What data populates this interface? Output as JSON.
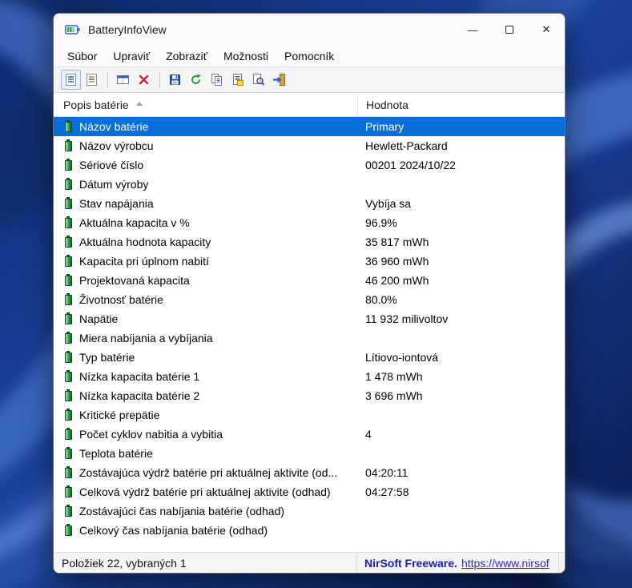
{
  "window": {
    "title": "BatteryInfoView",
    "controls": {
      "minimize": "—",
      "maximize": "□",
      "close": "✕"
    }
  },
  "menubar": {
    "items": [
      "Súbor",
      "Upraviť",
      "Zobraziť",
      "Možnosti",
      "Pomocník"
    ]
  },
  "toolbar": {
    "icons": [
      "report-view-icon",
      "log-view-icon",
      "choose-columns-icon",
      "delete-icon",
      "save-icon",
      "refresh-icon",
      "copy-icon",
      "properties-icon",
      "find-icon",
      "exit-icon"
    ]
  },
  "list": {
    "columns": [
      {
        "label": "Popis batérie",
        "sorted": true
      },
      {
        "label": "Hodnota"
      }
    ],
    "selection_color": "#0a6ed8",
    "row_icon": "battery-icon",
    "rows": [
      {
        "label": "Názov batérie",
        "value": "Primary",
        "selected": true
      },
      {
        "label": "Názov výrobcu",
        "value": "Hewlett-Packard"
      },
      {
        "label": "Sériové číslo",
        "value": "00201 2024/10/22"
      },
      {
        "label": "Dátum výroby",
        "value": ""
      },
      {
        "label": "Stav napájania",
        "value": "Vybíja sa"
      },
      {
        "label": "Aktuálna kapacita v %",
        "value": "96.9%"
      },
      {
        "label": "Aktuálna hodnota kapacity",
        "value": "35 817 mWh"
      },
      {
        "label": "Kapacita pri úplnom nabití",
        "value": "36 960 mWh"
      },
      {
        "label": "Projektovaná kapacita",
        "value": "46 200 mWh"
      },
      {
        "label": "Životnosť batérie",
        "value": "80.0%"
      },
      {
        "label": "Napätie",
        "value": "11 932 milivoltov"
      },
      {
        "label": "Miera nabíjania a vybíjania",
        "value": ""
      },
      {
        "label": "Typ batérie",
        "value": "Lítiovo-iontová"
      },
      {
        "label": "Nízka kapacita batérie 1",
        "value": "1 478 mWh"
      },
      {
        "label": "Nízka kapacita batérie 2",
        "value": "3 696 mWh"
      },
      {
        "label": "Kritické prepätie",
        "value": ""
      },
      {
        "label": "Počet cyklov nabitia a vybitia",
        "value": "4"
      },
      {
        "label": "Teplota batérie",
        "value": ""
      },
      {
        "label": "Zostávajúca výdrž batérie pri aktuálnej aktivite (od...",
        "value": "04:20:11"
      },
      {
        "label": "Celková výdrž batérie pri aktuálnej aktivite (odhad)",
        "value": "04:27:58"
      },
      {
        "label": "Zostávajúci čas nabíjania batérie (odhad)",
        "value": ""
      },
      {
        "label": "Celkový čas nabíjania batérie (odhad)",
        "value": ""
      }
    ]
  },
  "statusbar": {
    "items_text": "Položiek 22, vybraných 1",
    "brand_text": "NirSoft Freeware.",
    "link_text": "https://www.nirsof"
  }
}
